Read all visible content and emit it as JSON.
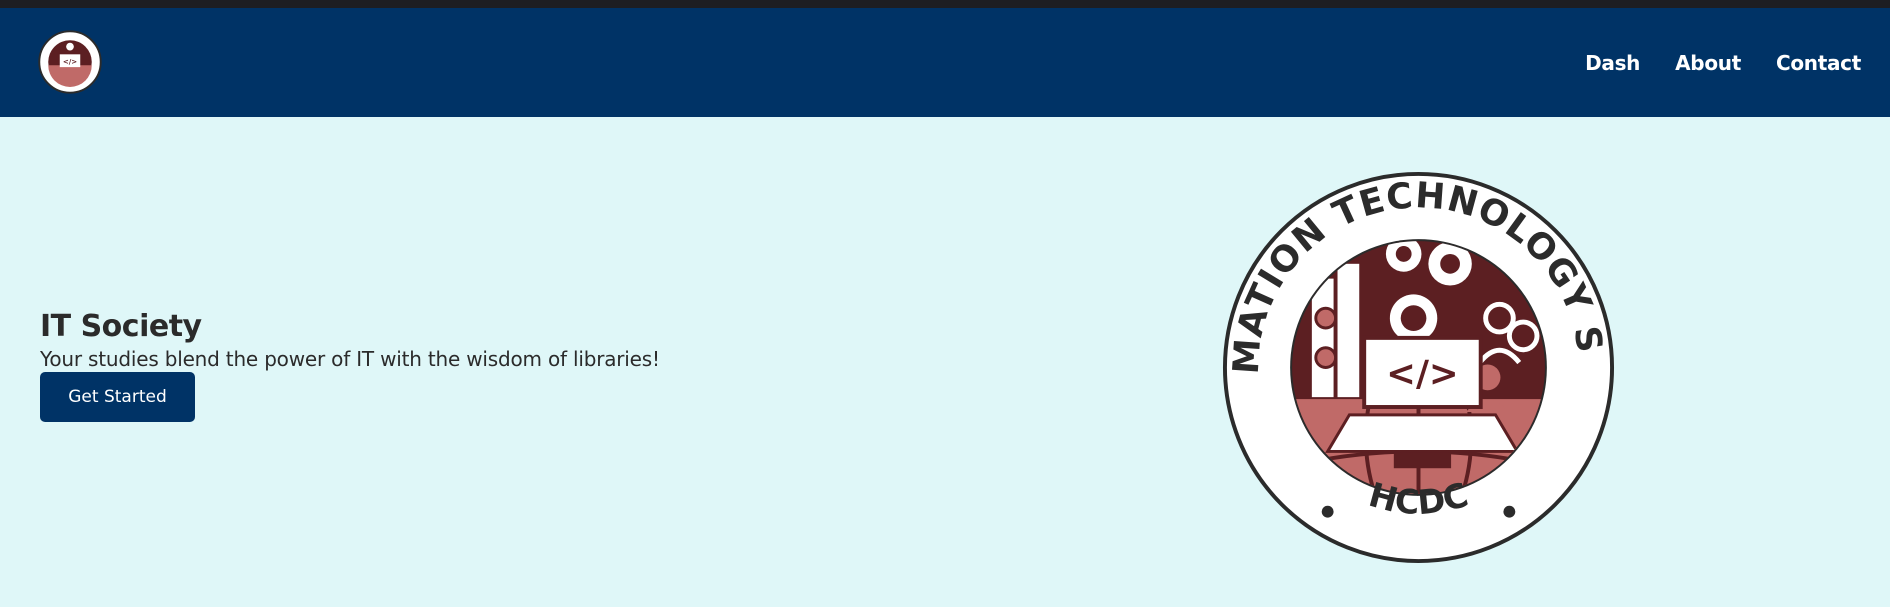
{
  "nav": {
    "links": [
      {
        "label": "Dash"
      },
      {
        "label": "About"
      },
      {
        "label": "Contact"
      }
    ]
  },
  "hero": {
    "title": "IT Society",
    "subtitle": "Your studies blend the power of IT with the wisdom of libraries!",
    "cta_label": "Get Started"
  },
  "logo": {
    "ring_text": "INFORMATION TECHNOLOGY SOCIETY",
    "bottom_text": "HCDC",
    "center_glyph": "</>"
  },
  "colors": {
    "navbar": "#003366",
    "background": "#dff7f8",
    "top_strip": "#1d1e22",
    "logo_maroon": "#5c1f22",
    "logo_rose": "#c06a68"
  }
}
